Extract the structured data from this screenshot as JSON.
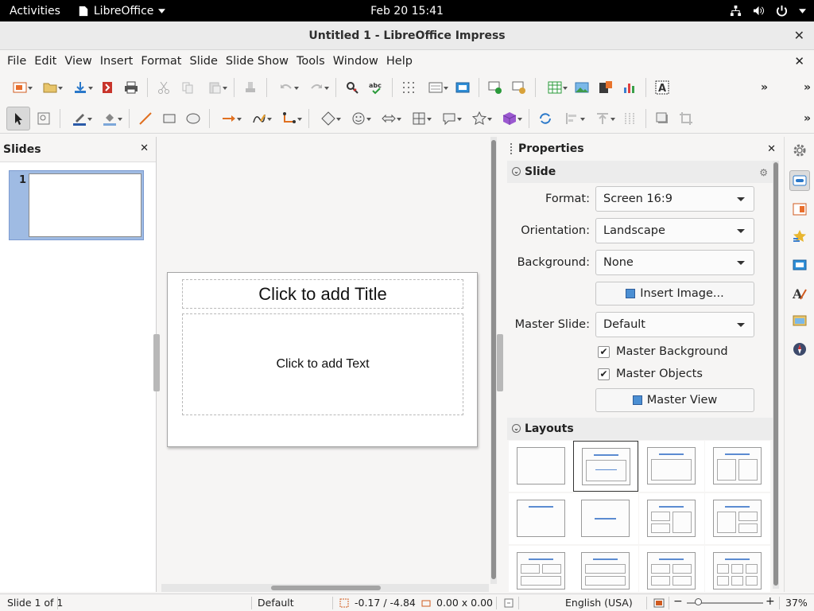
{
  "topbar": {
    "activities": "Activities",
    "app_name": "LibreOffice",
    "clock": "Feb 20  15:41"
  },
  "window": {
    "title": "Untitled 1 - LibreOffice Impress",
    "close": "✕"
  },
  "menu": [
    "File",
    "Edit",
    "View",
    "Insert",
    "Format",
    "Slide",
    "Slide Show",
    "Tools",
    "Window",
    "Help"
  ],
  "slides_pane": {
    "title": "Slides",
    "close": "✕",
    "slide_number": "1"
  },
  "slide": {
    "title_placeholder": "Click to add Title",
    "text_placeholder": "Click to add Text"
  },
  "properties": {
    "title": "Properties",
    "close": "✕",
    "section_slide": "Slide",
    "format_label": "Format:",
    "format_value": "Screen 16:9",
    "orientation_label": "Orientation:",
    "orientation_value": "Landscape",
    "background_label": "Background:",
    "background_value": "None",
    "insert_image": "Insert Image...",
    "master_slide_label": "Master Slide:",
    "master_slide_value": "Default",
    "master_background": "Master Background",
    "master_objects": "Master Objects",
    "master_view": "Master View",
    "section_layouts": "Layouts"
  },
  "status": {
    "slide": "Slide 1 of 1",
    "master": "Default",
    "position": "-0.17 / -4.84",
    "size": "0.00 x 0.00",
    "language": "English (USA)",
    "zoom": "37%",
    "zoom_minus": "−",
    "zoom_plus": "+"
  },
  "colors": {
    "accent": "#5b8bd1",
    "thumb_selected": "#9fbbe3"
  }
}
